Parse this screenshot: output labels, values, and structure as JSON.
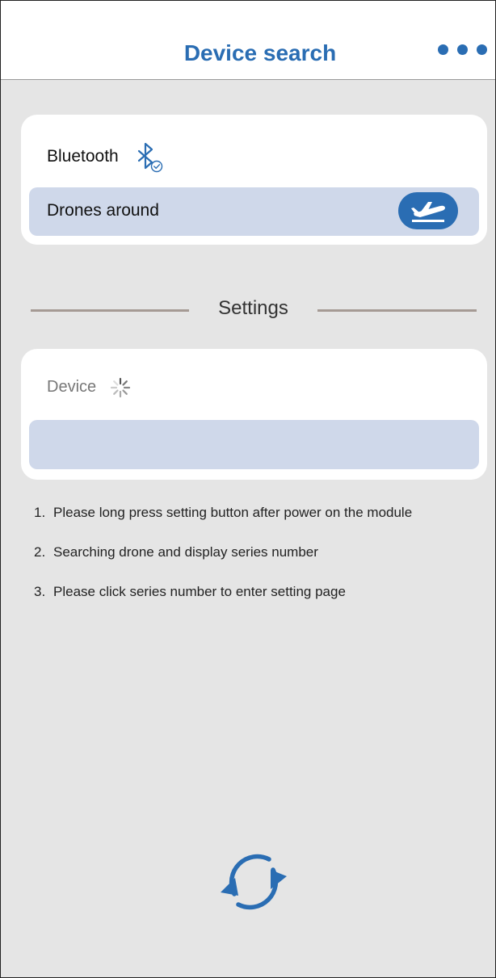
{
  "header": {
    "title": "Device search",
    "more_icon": "more-horizontal-icon"
  },
  "bluetooth_card": {
    "label": "Bluetooth",
    "status_icon": "bluetooth-connected-icon",
    "drones_row": {
      "label": "Drones around",
      "button_icon": "airplane-takeoff-icon"
    }
  },
  "settings": {
    "title": "Settings"
  },
  "device_card": {
    "label": "Device",
    "loading_icon": "loading-spinner-icon",
    "value": ""
  },
  "instructions": [
    {
      "num": "1.",
      "text": "Please long press setting button after power on the module"
    },
    {
      "num": "2.",
      "text": "Searching drone and display series number"
    },
    {
      "num": "3.",
      "text": "Please click series number to enter setting page"
    }
  ],
  "footer": {
    "refresh_icon": "refresh-icon"
  },
  "colors": {
    "accent": "#2a6db3",
    "row_bg": "#cfd8ea",
    "page_bg": "#e5e5e5",
    "divider": "#a59a94"
  }
}
